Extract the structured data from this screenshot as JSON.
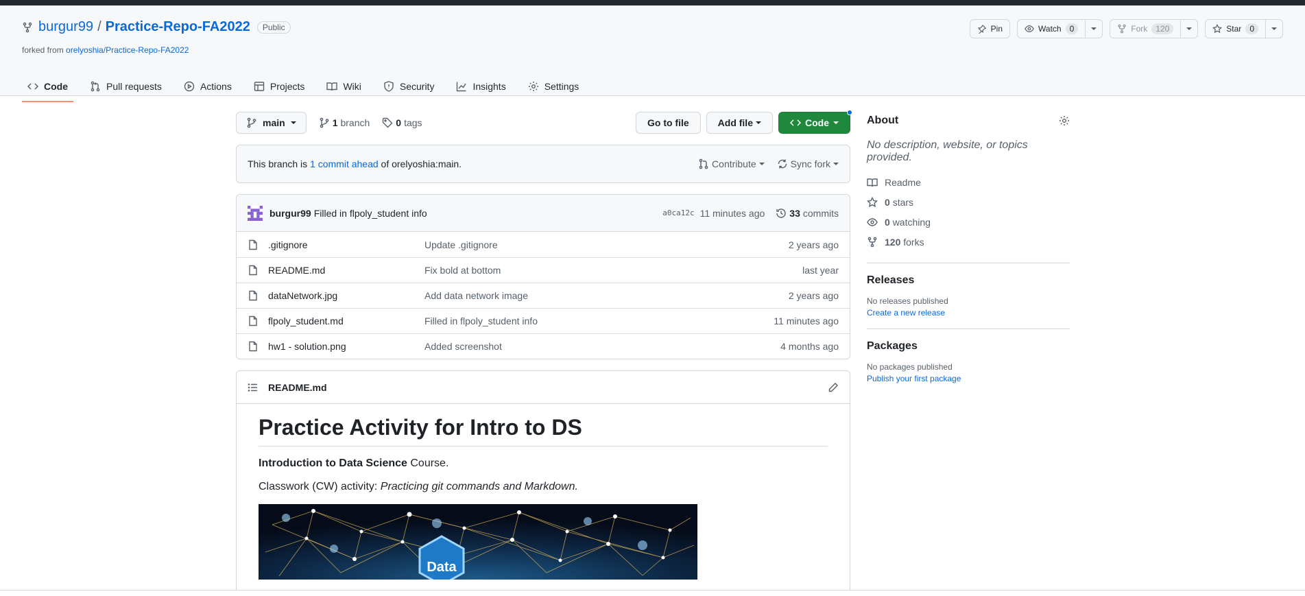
{
  "repo": {
    "owner": "burgur99",
    "separator": "/",
    "name": "Practice-Repo-FA2022",
    "visibility": "Public",
    "forked_prefix": "forked from",
    "forked_from": "orelyoshia/Practice-Repo-FA2022"
  },
  "head_actions": {
    "pin": "Pin",
    "watch": "Watch",
    "watch_count": "0",
    "fork": "Fork",
    "fork_count": "120",
    "star": "Star",
    "star_count": "0"
  },
  "tabs": [
    {
      "label": "Code",
      "icon": "code-icon",
      "selected": true
    },
    {
      "label": "Pull requests",
      "icon": "pull-request-icon"
    },
    {
      "label": "Actions",
      "icon": "play-icon"
    },
    {
      "label": "Projects",
      "icon": "table-icon"
    },
    {
      "label": "Wiki",
      "icon": "book-icon"
    },
    {
      "label": "Security",
      "icon": "shield-icon"
    },
    {
      "label": "Insights",
      "icon": "graph-icon"
    },
    {
      "label": "Settings",
      "icon": "gear-icon"
    }
  ],
  "toolbar": {
    "branch": "main",
    "branch_count": "1",
    "branch_word": "branch",
    "tag_count": "0",
    "tag_word": "tags",
    "goto_file": "Go to file",
    "add_file": "Add file",
    "code": "Code"
  },
  "ahead": {
    "prefix": "This branch is",
    "link": "1 commit ahead",
    "suffix": "of orelyoshia:main.",
    "contribute": "Contribute",
    "sync": "Sync fork"
  },
  "latest_commit": {
    "author": "burgur99",
    "message": "Filled in flpoly_student info",
    "sha": "a0ca12c",
    "time": "11 minutes ago",
    "commit_count": "33",
    "commit_word": "commits"
  },
  "files": [
    {
      "name": ".gitignore",
      "message": "Update .gitignore",
      "age": "2 years ago"
    },
    {
      "name": "README.md",
      "message": "Fix bold at bottom",
      "age": "last year"
    },
    {
      "name": "dataNetwork.jpg",
      "message": "Add data network image",
      "age": "2 years ago"
    },
    {
      "name": "flpoly_student.md",
      "message": "Filled in flpoly_student info",
      "age": "11 minutes ago"
    },
    {
      "name": "hw1 - solution.png",
      "message": "Added screenshot",
      "age": "4 months ago"
    }
  ],
  "readme": {
    "filename": "README.md",
    "heading": "Practice Activity for Intro to DS",
    "p1_bold": "Introduction to Data Science",
    "p1_rest": " Course.",
    "p2_plain": "Classwork (CW) activity: ",
    "p2_italic": "Practicing git commands and Markdown.",
    "image_label": "Data"
  },
  "about": {
    "title": "About",
    "description": "No description, website, or topics provided.",
    "readme": "Readme",
    "stars_count": "0",
    "stars_word": "stars",
    "watching_count": "0",
    "watching_word": "watching",
    "forks_count": "120",
    "forks_word": "forks"
  },
  "releases": {
    "title": "Releases",
    "empty": "No releases published",
    "link": "Create a new release"
  },
  "packages": {
    "title": "Packages",
    "empty": "No packages published",
    "link": "Publish your first package"
  },
  "colors": {
    "primary_green": "#1f883d",
    "link_blue": "#0969da",
    "tab_underline": "#fd8c73"
  }
}
